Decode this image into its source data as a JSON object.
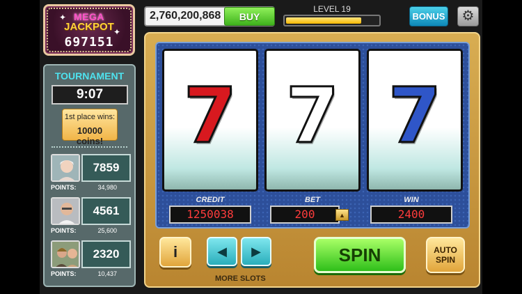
{
  "jackpot": {
    "line1": "MEGA",
    "line2": "JACKPOT",
    "amount": "697151"
  },
  "topbar": {
    "coins": "2,760,200,868",
    "buy_label": "BUY",
    "level_label": "LEVEL 19",
    "level_progress": 0.82,
    "bonus_label": "BONUS",
    "settings_icon": "gear-icon"
  },
  "tournament": {
    "title": "TOURNAMENT",
    "timer": "9:07",
    "prize_line1": "1st place wins:",
    "prize_line2": "10000 coins!",
    "entries": [
      {
        "score": "7859",
        "points_label": "POINTS:",
        "points": "34,980"
      },
      {
        "score": "4561",
        "points_label": "POINTS:",
        "points": "25,600"
      },
      {
        "score": "2320",
        "points_label": "POINTS:",
        "points": "10,437"
      }
    ]
  },
  "machine": {
    "reels": [
      {
        "symbol": "7",
        "color": "#d8191f"
      },
      {
        "symbol": "7",
        "color": "#ffffff"
      },
      {
        "symbol": "7",
        "color": "#2f56c8"
      }
    ],
    "credit_label": "CREDIT",
    "credit": "1250038",
    "bet_label": "BET",
    "bet": "200",
    "win_label": "WIN",
    "win": "2400",
    "info_label": "i",
    "prev_label": "◀",
    "next_label": "▶",
    "more_slots_label": "MORE SLOTS",
    "spin_label": "SPIN",
    "auto_spin_line1": "AUTO",
    "auto_spin_line2": "SPIN"
  }
}
